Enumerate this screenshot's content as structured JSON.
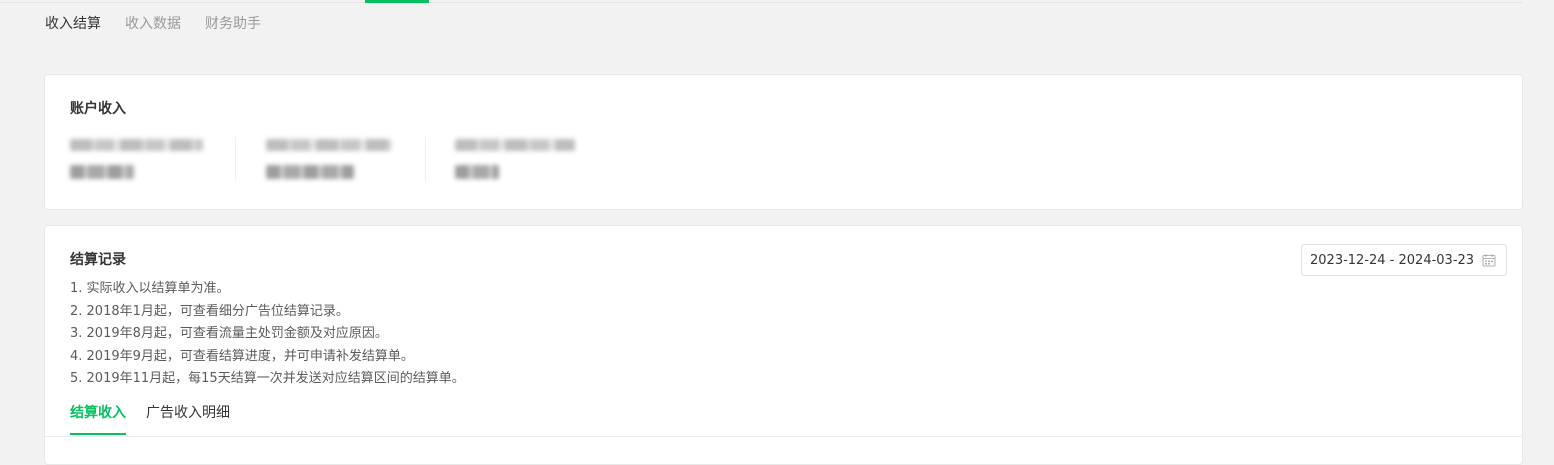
{
  "main_tabs": [
    {
      "label": "收入结算",
      "active": true
    },
    {
      "label": "收入数据",
      "active": false
    },
    {
      "label": "财务助手",
      "active": false
    }
  ],
  "account_income": {
    "title": "账户收入",
    "items": [
      {
        "label": "████ ███ ██",
        "value": "████"
      },
      {
        "label": "████ ███ ██",
        "value": "██████"
      },
      {
        "label": "████ ███ ██",
        "value": "███"
      }
    ]
  },
  "settlement": {
    "title": "结算记录",
    "notes": [
      "1. 实际收入以结算单为准。",
      "2. 2018年1月起，可查看细分广告位结算记录。",
      "3. 2019年8月起，可查看流量主处罚金额及对应原因。",
      "4. 2019年9月起，可查看结算进度，并可申请补发结算单。",
      "5. 2019年11月起，每15天结算一次并发送对应结算区间的结算单。"
    ],
    "date_range": "2023-12-24 - 2024-03-23",
    "tabs": [
      {
        "label": "结算收入",
        "active": true
      },
      {
        "label": "广告收入明细",
        "active": false
      }
    ]
  },
  "colors": {
    "accent": "#07c160",
    "background": "#f2f2f2",
    "card": "#ffffff",
    "text": "#353535",
    "muted": "#9a9a9a"
  },
  "icons": {
    "calendar": "calendar-icon"
  }
}
